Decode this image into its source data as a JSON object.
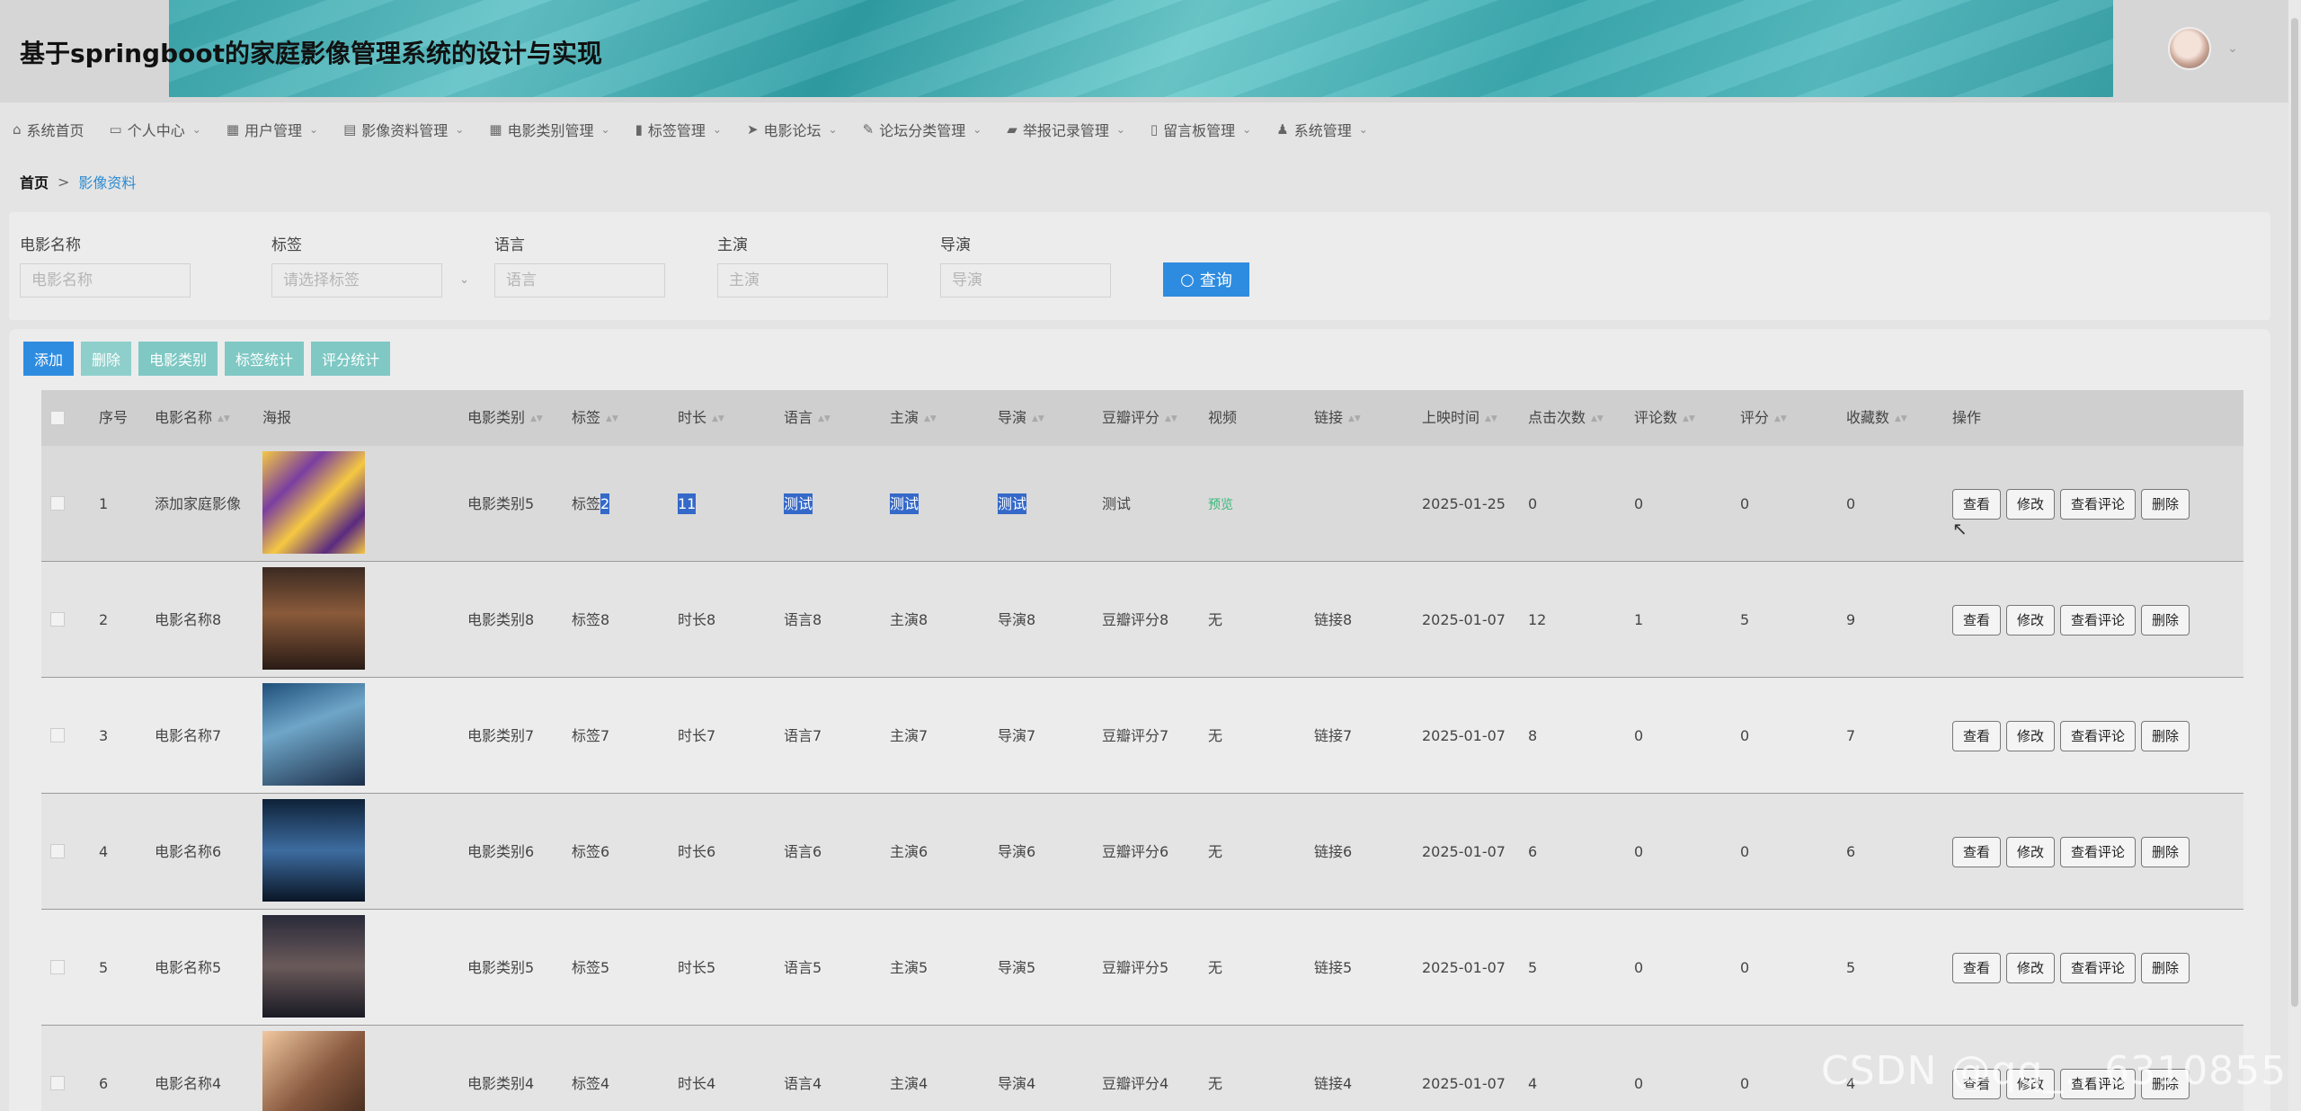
{
  "header": {
    "title": "基于springboot的家庭影像管理系统的设计与实现"
  },
  "nav": [
    {
      "icon": "⌂",
      "label": "系统首页",
      "caret": false
    },
    {
      "icon": "▭",
      "label": "个人中心",
      "caret": true
    },
    {
      "icon": "▦",
      "label": "用户管理",
      "caret": true
    },
    {
      "icon": "▤",
      "label": "影像资料管理",
      "caret": true
    },
    {
      "icon": "▦",
      "label": "电影类别管理",
      "caret": true
    },
    {
      "icon": "▮",
      "label": "标签管理",
      "caret": true
    },
    {
      "icon": "➤",
      "label": "电影论坛",
      "caret": true
    },
    {
      "icon": "✎",
      "label": "论坛分类管理",
      "caret": true
    },
    {
      "icon": "▰",
      "label": "举报记录管理",
      "caret": true
    },
    {
      "icon": "▯",
      "label": "留言板管理",
      "caret": true
    },
    {
      "icon": "♟",
      "label": "系统管理",
      "caret": true
    }
  ],
  "breadcrumb": {
    "home": "首页",
    "sep": ">",
    "current": "影像资料"
  },
  "search": {
    "fields": [
      {
        "label": "电影名称",
        "placeholder": "电影名称"
      },
      {
        "label": "标签",
        "placeholder": "请选择标签"
      },
      {
        "label": "语言",
        "placeholder": "语言"
      },
      {
        "label": "主演",
        "placeholder": "主演"
      },
      {
        "label": "导演",
        "placeholder": "导演"
      }
    ],
    "button": "查询"
  },
  "actions": {
    "add": "添加",
    "delete": "删除",
    "category": "电影类别",
    "tag_stats": "标签统计",
    "score_stats": "评分统计"
  },
  "table": {
    "headers": [
      "序号",
      "电影名称",
      "海报",
      "电影类别",
      "标签",
      "时长",
      "语言",
      "主演",
      "导演",
      "豆瓣评分",
      "视频",
      "链接",
      "上映时间",
      "点击次数",
      "评论数",
      "评分",
      "收藏数",
      "操作"
    ],
    "op_labels": [
      "查看",
      "修改",
      "查看评论",
      "删除"
    ],
    "rows": [
      {
        "no": "1",
        "name": "添加家庭影像",
        "category": "电影类别5",
        "tag": "标签2",
        "duration": "11",
        "language": "测试",
        "actor": "测试",
        "director": "测试",
        "douban": "测试",
        "video": "预览",
        "link": "",
        "date": "2025-01-25",
        "clicks": "0",
        "comments": "0",
        "score": "0",
        "favs": "0"
      },
      {
        "no": "2",
        "name": "电影名称8",
        "category": "电影类别8",
        "tag": "标签8",
        "duration": "时长8",
        "language": "语言8",
        "actor": "主演8",
        "director": "导演8",
        "douban": "豆瓣评分8",
        "video": "无",
        "link": "链接8",
        "date": "2025-01-07",
        "clicks": "12",
        "comments": "1",
        "score": "5",
        "favs": "9"
      },
      {
        "no": "3",
        "name": "电影名称7",
        "category": "电影类别7",
        "tag": "标签7",
        "duration": "时长7",
        "language": "语言7",
        "actor": "主演7",
        "director": "导演7",
        "douban": "豆瓣评分7",
        "video": "无",
        "link": "链接7",
        "date": "2025-01-07",
        "clicks": "8",
        "comments": "0",
        "score": "0",
        "favs": "7"
      },
      {
        "no": "4",
        "name": "电影名称6",
        "category": "电影类别6",
        "tag": "标签6",
        "duration": "时长6",
        "language": "语言6",
        "actor": "主演6",
        "director": "导演6",
        "douban": "豆瓣评分6",
        "video": "无",
        "link": "链接6",
        "date": "2025-01-07",
        "clicks": "6",
        "comments": "0",
        "score": "0",
        "favs": "6"
      },
      {
        "no": "5",
        "name": "电影名称5",
        "category": "电影类别5",
        "tag": "标签5",
        "duration": "时长5",
        "language": "语言5",
        "actor": "主演5",
        "director": "导演5",
        "douban": "豆瓣评分5",
        "video": "无",
        "link": "链接5",
        "date": "2025-01-07",
        "clicks": "5",
        "comments": "0",
        "score": "0",
        "favs": "5"
      },
      {
        "no": "6",
        "name": "电影名称4",
        "category": "电影类别4",
        "tag": "标签4",
        "duration": "时长4",
        "language": "语言4",
        "actor": "主演4",
        "director": "导演4",
        "douban": "豆瓣评分4",
        "video": "无",
        "link": "链接4",
        "date": "2025-01-07",
        "clicks": "4",
        "comments": "0",
        "score": "0",
        "favs": "4"
      }
    ]
  },
  "watermark": "CSDN @qq_...6310855",
  "colors": {
    "primary": "#2e8ce0",
    "teal": "#7fc8c4",
    "highlight": "#3569c9",
    "preview": "#3ab87a"
  }
}
